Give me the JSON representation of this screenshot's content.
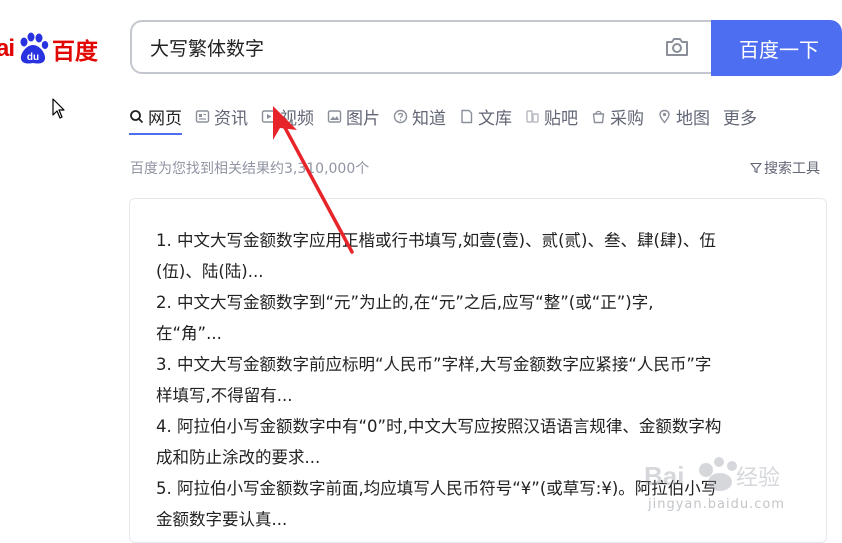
{
  "logo": {
    "latin": "ai",
    "paw_text": "du",
    "chinese": "百度"
  },
  "search": {
    "value": "大写繁体数字",
    "button": "百度一下",
    "camera_icon": "camera-icon"
  },
  "tabs": [
    {
      "label": "网页",
      "icon": "search-icon",
      "active": true
    },
    {
      "label": "资讯",
      "icon": "news-icon",
      "active": false
    },
    {
      "label": "视频",
      "icon": "video-icon",
      "active": false
    },
    {
      "label": "图片",
      "icon": "image-icon",
      "active": false
    },
    {
      "label": "知道",
      "icon": "question-icon",
      "active": false
    },
    {
      "label": "文库",
      "icon": "document-icon",
      "active": false
    },
    {
      "label": "贴吧",
      "icon": "tieba-icon",
      "active": false
    },
    {
      "label": "采购",
      "icon": "shopping-icon",
      "active": false
    },
    {
      "label": "地图",
      "icon": "map-icon",
      "active": false
    },
    {
      "label": "更多",
      "icon": "",
      "active": false
    }
  ],
  "results": {
    "count_text": "百度为您找到相关结果约3,310,000个",
    "tools_label": "搜索工具"
  },
  "snippet": {
    "lines": [
      "1. 中文大写金额数字应用正楷或行书填写,如壹(壹)、贰(贰)、叁、肆(肆)、伍",
      "(伍)、陆(陆)...",
      "2. 中文大写金额数字到“元”为止的,在“元”之后,应写“整”(或“正”)字,",
      "在“角”...",
      "3. 中文大写金额数字前应标明“人民币”字样,大写金额数字应紧接“人民币”字",
      "样填写,不得留有...",
      "4. 阿拉伯小写金额数字中有“0”时,中文大写应按照汉语语言规律、金额数字构",
      "成和防止涂改的要求...",
      "5. 阿拉伯小写金额数字前面,均应填写人民币符号“¥”(或草写:¥)。阿拉伯小写",
      "金额数字要认真..."
    ]
  },
  "watermark": {
    "text": "jingyan.baidu.com"
  },
  "colors": {
    "brand_red": "#e10601",
    "brand_blue": "#4e6ef2",
    "arrow_red": "#e8242b"
  }
}
